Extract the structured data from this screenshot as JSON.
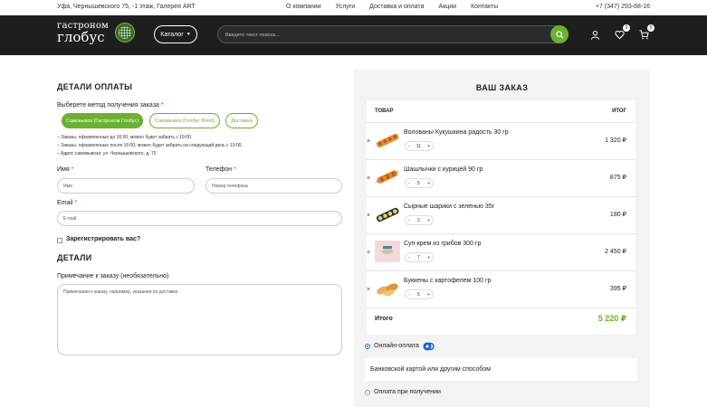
{
  "topbar": {
    "address": "Уфа, Чернышевского 75, -1 этаж, Галерея ART",
    "nav": [
      "О компании",
      "Услуги",
      "Доставка и оплата",
      "Акции",
      "Контакты"
    ],
    "phone": "+7 (347) 293-68-16"
  },
  "header": {
    "logo_line1": "гастроном",
    "logo_line2": "глобус",
    "catalog_label": "Каталог",
    "search_placeholder": "Введите текст поиска...",
    "wishlist_count": "0",
    "cart_count": "0",
    "accent_color": "#6ab12f"
  },
  "payment_details": {
    "title": "ДЕТАЛИ ОПЛАТЫ",
    "method_label": "Выберете метод получения заказа",
    "required_mark": "*",
    "methods": [
      {
        "label": "Самовывоз (Гастроном Глобус)",
        "active": true
      },
      {
        "label": "Самовывоз (Глобус Point)",
        "active": false
      },
      {
        "label": "Доставка",
        "active": false
      }
    ],
    "notes": [
      "– Заказы, оформленные до 16:00, можно будет забрать с 19:00.",
      "– Заказы, оформленные после 16:00, можно будет забрать на следующий день с 13:00.",
      "– Адрес самовывоза: ул. Чернышевского, д. 75"
    ],
    "name_label": "Имя",
    "name_placeholder": "Имя",
    "phone_label": "Телефон",
    "phone_placeholder": "Номер телефона",
    "email_label": "Email",
    "email_placeholder": "E-mail",
    "register_label": "Зарегистрировать вас?"
  },
  "details": {
    "title": "ДЕТАЛИ",
    "comment_label": "Примечание к заказу (необязательно)",
    "comment_placeholder": "Примечания к заказу, например, указания по доставке."
  },
  "order": {
    "title": "ВАШ ЗАКАЗ",
    "col_product": "ТОВАР",
    "col_total": "ИТОГ",
    "remove_symbol": "×",
    "minus": "-",
    "plus": "+",
    "items": [
      {
        "name": "Волованы Кукушкина радость 30 гр",
        "qty": "11",
        "price": "1 320 ₽"
      },
      {
        "name": "Шашлычки с курицей 90 гр",
        "qty": "5",
        "price": "875 ₽"
      },
      {
        "name": "Сырные шарики с зеленью 35г",
        "qty": "2",
        "price": "180 ₽"
      },
      {
        "name": "Суп-крем из грибов 300 гр",
        "qty": "7",
        "price": "2 450 ₽"
      },
      {
        "name": "Буккены с картофелем 100 гр",
        "qty": "5",
        "price": "395 ₽"
      }
    ],
    "total_label": "Итого",
    "total_value": "5 220 ₽"
  },
  "payment": {
    "online_label": "Онлайн-оплата",
    "online_desc": "Банковской картой или другим способом",
    "cod_label": "Оплата при получении"
  }
}
